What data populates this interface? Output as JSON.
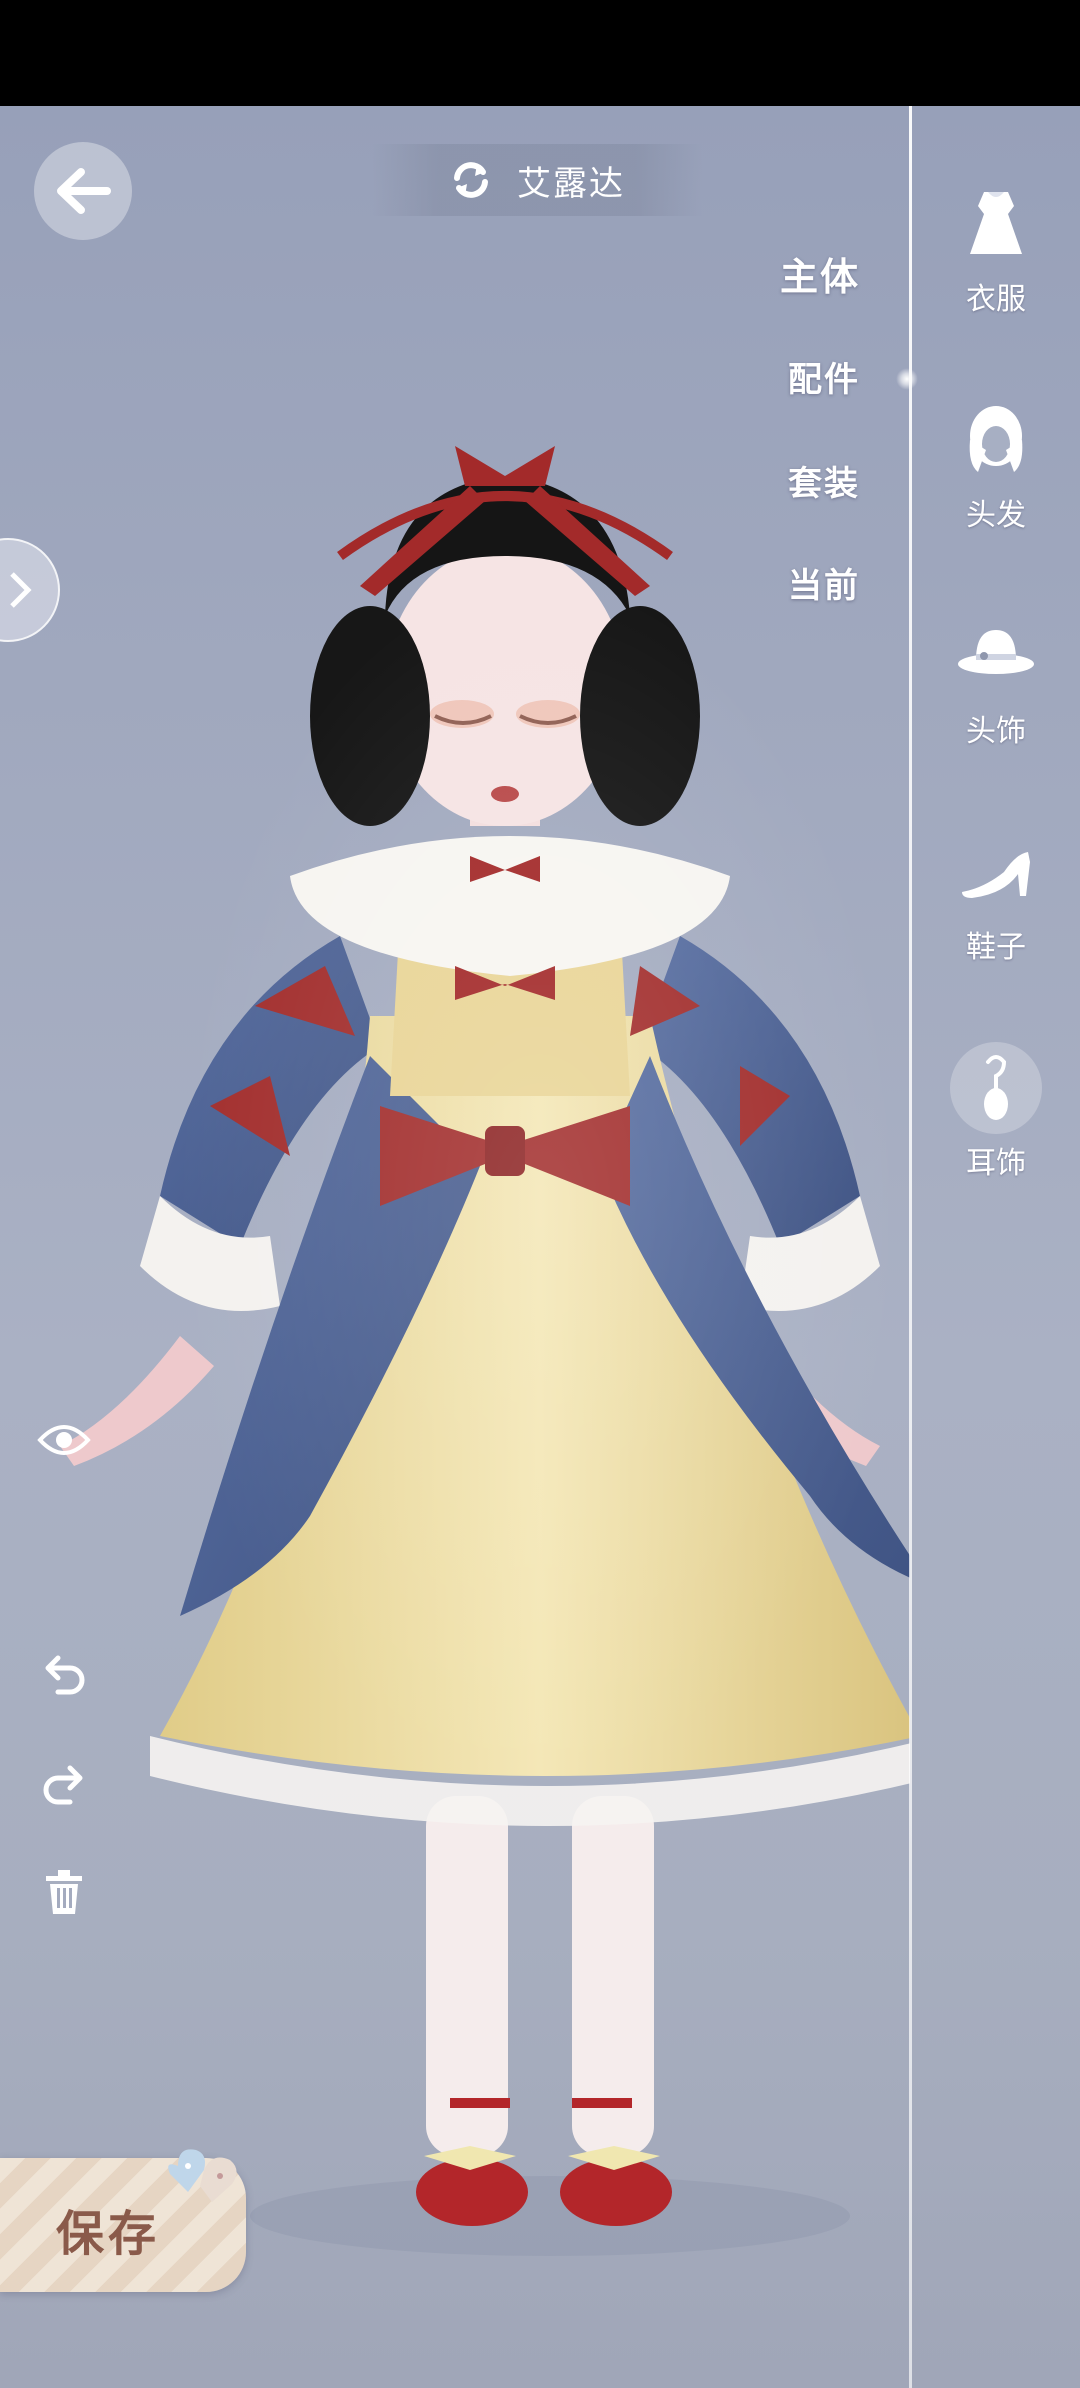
{
  "header": {
    "character_name": "艾露达"
  },
  "tabs": [
    {
      "label": "主体",
      "active": true
    },
    {
      "label": "配件",
      "active": false
    },
    {
      "label": "套装",
      "active": false
    },
    {
      "label": "当前",
      "active": false
    }
  ],
  "categories": [
    {
      "label": "衣服",
      "icon": "dress-icon"
    },
    {
      "label": "头发",
      "icon": "hair-icon"
    },
    {
      "label": "头饰",
      "icon": "hat-icon"
    },
    {
      "label": "鞋子",
      "icon": "high-heel-icon"
    },
    {
      "label": "耳饰",
      "icon": "earring-icon"
    }
  ],
  "tools": [
    "eye-icon",
    "undo-icon",
    "redo-icon",
    "trash-icon"
  ],
  "save": {
    "label": "保存"
  },
  "colors": {
    "background": "#a3aac0",
    "dress_blue": "#4f6595",
    "dress_yellow": "#ecdca0",
    "bow_red": "#a33030",
    "save_text": "#8a5a4a"
  }
}
